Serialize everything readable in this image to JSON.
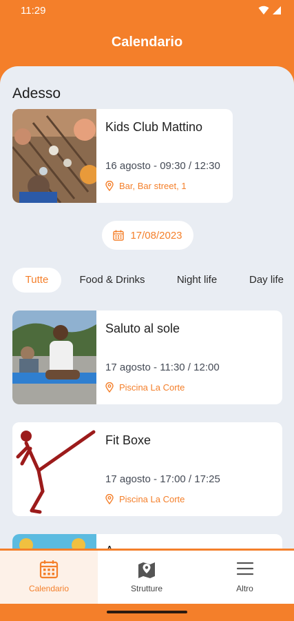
{
  "status_bar": {
    "time": "11:29"
  },
  "header": {
    "title": "Calendario"
  },
  "now_section": {
    "title": "Adesso",
    "event": {
      "title": "Kids Club Mattino",
      "time": "16 agosto - 09:30 / 12:30",
      "location": "Bar, Bar street, 1"
    }
  },
  "date_picker": {
    "date": "17/08/2023",
    "icon": "calendar-icon"
  },
  "filters": [
    {
      "label": "Tutte",
      "active": true
    },
    {
      "label": "Food & Drinks",
      "active": false
    },
    {
      "label": "Night life",
      "active": false
    },
    {
      "label": "Day life",
      "active": false
    }
  ],
  "events": [
    {
      "title": "Saluto al sole",
      "time": "17 agosto - 11:30 / 12:00",
      "location": "Piscina La Corte"
    },
    {
      "title": "Fit Boxe",
      "time": "17 agosto - 17:00 / 17:25",
      "location": "Piscina La Corte"
    },
    {
      "title": "A"
    }
  ],
  "bottom_nav": [
    {
      "label": "Calendario",
      "icon": "calendar-icon",
      "active": true
    },
    {
      "label": "Strutture",
      "icon": "map-icon",
      "active": false
    },
    {
      "label": "Altro",
      "icon": "menu-icon",
      "active": false
    }
  ],
  "colors": {
    "accent": "#f47f2a",
    "background": "#e9edf3",
    "card": "#ffffff",
    "text": "#1f1f1f"
  }
}
